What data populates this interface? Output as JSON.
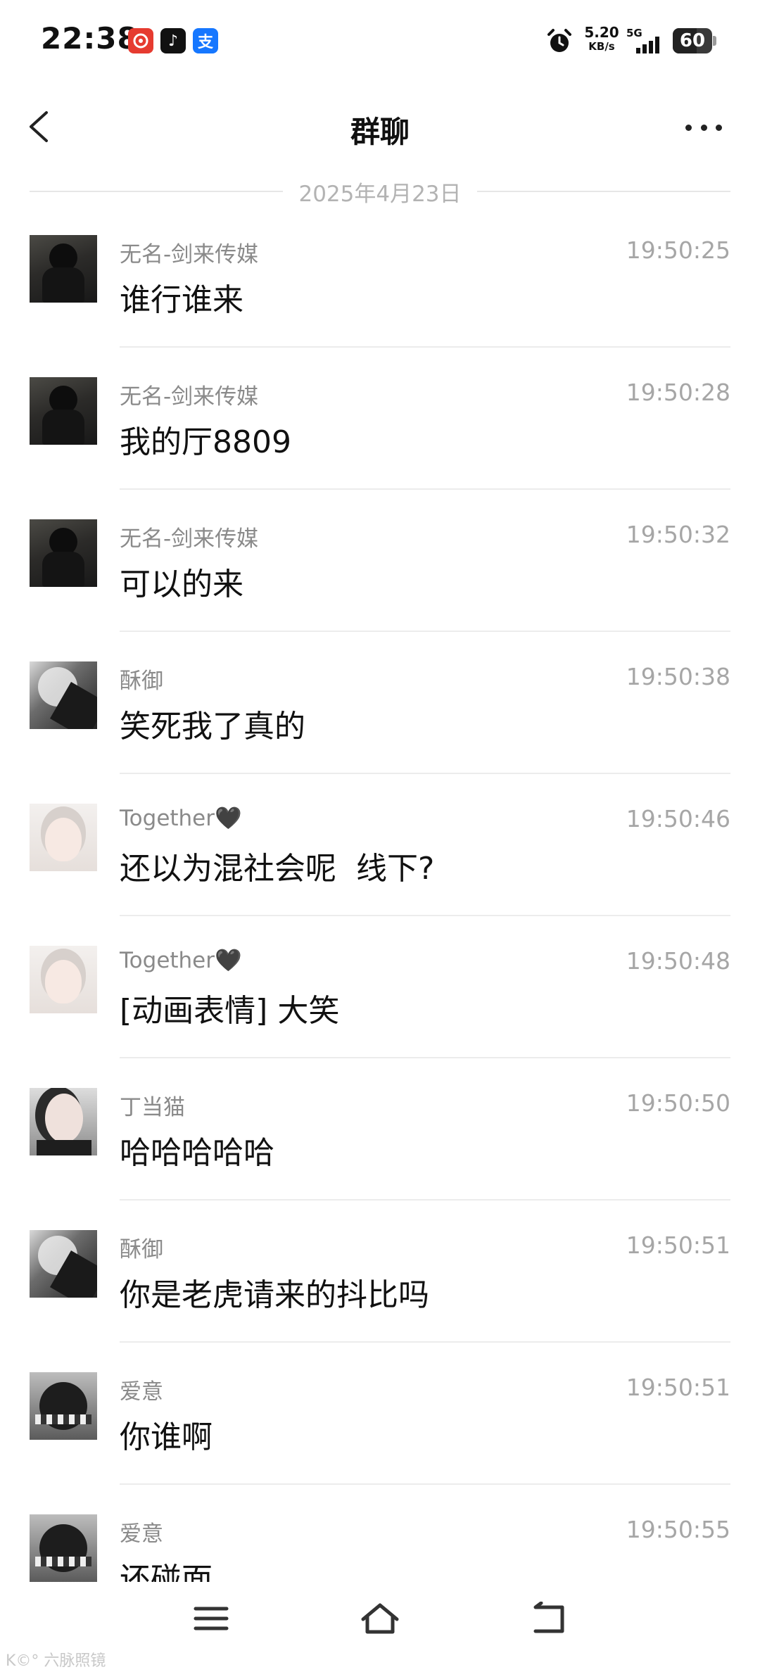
{
  "status_bar": {
    "time": "22:38",
    "apps": [
      "netease-music-icon",
      "tiktok-icon",
      "alipay-icon"
    ],
    "app_glyphs": {
      "tiktok": "♪",
      "alipay": "支"
    },
    "net_speed_value": "5.20",
    "net_speed_unit": "KB/s",
    "network": "5G",
    "battery_level": "60",
    "battery_fraction": 0.6
  },
  "header": {
    "title": "群聊"
  },
  "date_divider": "2025年4月23日",
  "messages": [
    {
      "sender": "无名-剑来传媒",
      "time": "19:50:25",
      "text": "谁行谁来",
      "avatar": "av-dark"
    },
    {
      "sender": "无名-剑来传媒",
      "time": "19:50:28",
      "text": "我的厅8809",
      "avatar": "av-dark"
    },
    {
      "sender": "无名-剑来传媒",
      "time": "19:50:32",
      "text": "可以的来",
      "avatar": "av-dark"
    },
    {
      "sender": "酥御",
      "time": "19:50:38",
      "text": "笑死我了真的",
      "avatar": "av-gray"
    },
    {
      "sender": "Together🖤",
      "time": "19:50:46",
      "text": "还以为混社会呢  线下?",
      "avatar": "av-light"
    },
    {
      "sender": "Together🖤",
      "time": "19:50:48",
      "text": "[动画表情] 大笑",
      "avatar": "av-light"
    },
    {
      "sender": "丁当猫",
      "time": "19:50:50",
      "text": "哈哈哈哈哈",
      "avatar": "av-girl"
    },
    {
      "sender": "酥御",
      "time": "19:50:51",
      "text": "你是老虎请来的抖比吗",
      "avatar": "av-gray"
    },
    {
      "sender": "爱意",
      "time": "19:50:51",
      "text": "你谁啊",
      "avatar": "av-bw"
    },
    {
      "sender": "爱意",
      "time": "19:50:55",
      "text": "还碰面",
      "avatar": "av-bw"
    }
  ],
  "watermark": "K©° 六脉照镜",
  "colors": {
    "background": "#ffffff",
    "sender_text": "#8a8a8a",
    "timestamp_text": "#a6a6a6",
    "message_text": "#111111",
    "divider": "#ececec"
  }
}
